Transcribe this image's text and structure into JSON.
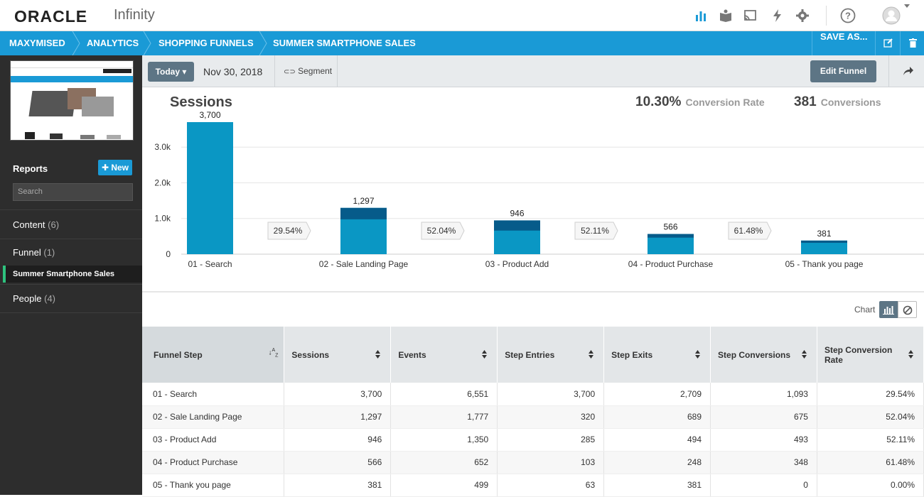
{
  "header": {
    "logo": "ORACLE",
    "product": "Infinity"
  },
  "icons": [
    "bar-chart-icon",
    "book-icon",
    "cast-icon",
    "bolt-icon",
    "gear-icon",
    "help-icon",
    "user-avatar-icon"
  ],
  "breadcrumb": {
    "items": [
      "MAXYMISED",
      "ANALYTICS",
      "SHOPPING FUNNELS",
      "SUMMER SMARTPHONE SALES"
    ],
    "save_as": "SAVE AS..."
  },
  "sidebar": {
    "reports_label": "Reports",
    "new_label": "New",
    "search_placeholder": "Search",
    "groups": [
      {
        "label": "Content",
        "count": "(6)"
      },
      {
        "label": "Funnel",
        "count": "(1)"
      },
      {
        "label": "People",
        "count": "(4)"
      }
    ],
    "active_item": "Summer Smartphone Sales"
  },
  "toolbar": {
    "today_label": "Today",
    "date": "Nov 30, 2018",
    "segment_label": "Segment",
    "edit_funnel_label": "Edit Funnel"
  },
  "kpis": {
    "conversion_rate_value": "10.30%",
    "conversion_rate_label": "Conversion Rate",
    "conversions_value": "381",
    "conversions_label": "Conversions"
  },
  "chart_data": {
    "type": "bar",
    "title": "Sessions",
    "categories": [
      "01 - Search",
      "02 - Sale Landing Page",
      "03 - Product Add",
      "04 - Product Purchase",
      "05 - Thank you page"
    ],
    "values": [
      3700,
      1297,
      946,
      566,
      381
    ],
    "value_labels": [
      "3,700",
      "1,297",
      "946",
      "566",
      "381"
    ],
    "step_entries": [
      3700,
      320,
      285,
      103,
      63
    ],
    "step_rates": [
      "29.54%",
      "52.04%",
      "52.11%",
      "61.48%"
    ],
    "ylim": [
      0,
      3700
    ],
    "yticks": [
      0,
      1000,
      2000,
      3000
    ],
    "ytick_labels": [
      "0",
      "1.0k",
      "2.0k",
      "3.0k"
    ],
    "grid": true,
    "colors": {
      "main": "#0a97c4",
      "dark": "#065b8a"
    }
  },
  "chart_toggle_label": "Chart",
  "table": {
    "headers": [
      "Funnel Step",
      "Sessions",
      "Events",
      "Step Entries",
      "Step Exits",
      "Step Conversions",
      "Step Conversion Rate"
    ],
    "rows": [
      [
        "01 - Search",
        "3,700",
        "6,551",
        "3,700",
        "2,709",
        "1,093",
        "29.54%"
      ],
      [
        "02 - Sale Landing Page",
        "1,297",
        "1,777",
        "320",
        "689",
        "675",
        "52.04%"
      ],
      [
        "03 - Product Add",
        "946",
        "1,350",
        "285",
        "494",
        "493",
        "52.11%"
      ],
      [
        "04 - Product Purchase",
        "566",
        "652",
        "103",
        "248",
        "348",
        "61.48%"
      ],
      [
        "05 - Thank you page",
        "381",
        "499",
        "63",
        "381",
        "0",
        "0.00%"
      ]
    ]
  }
}
